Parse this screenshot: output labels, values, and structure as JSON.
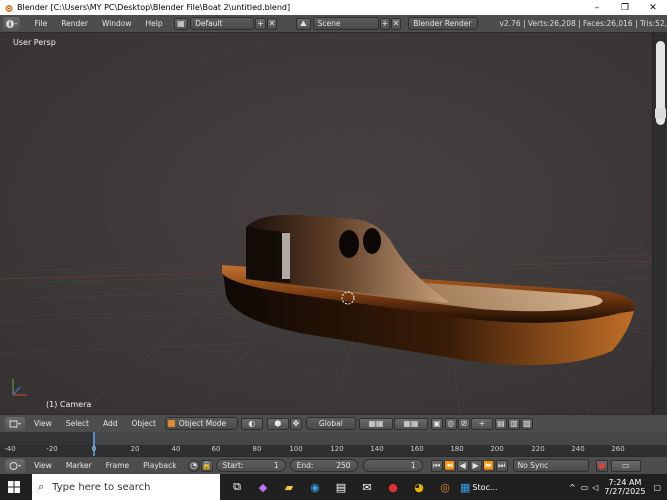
{
  "window": {
    "title": "Blender [C:\\Users\\MY PC\\Desktop\\Blender File\\Boat 2\\untitled.blend]",
    "minimize": "–",
    "maximize": "❐",
    "close": "✕"
  },
  "infobar": {
    "menus": [
      "File",
      "Render",
      "Window",
      "Help"
    ],
    "layout": "Default",
    "scene": "Scene",
    "engine": "Blender Render",
    "stats": "v2.76 | Verts:26,208 | Faces:26,016 | Tris:52,"
  },
  "viewport": {
    "view_label": "User Persp",
    "object_label": "(1) Camera"
  },
  "view_header": {
    "menus": [
      "View",
      "Select",
      "Add",
      "Object"
    ],
    "mode": "Object Mode",
    "orientation": "Global"
  },
  "timeline": {
    "ticks": [
      "-40",
      "-20",
      "0",
      "20",
      "40",
      "60",
      "80",
      "100",
      "120",
      "140",
      "160",
      "180",
      "200",
      "220",
      "240",
      "260"
    ]
  },
  "timeline_header": {
    "menus": [
      "View",
      "Marker",
      "Frame",
      "Playback"
    ],
    "start_label": "Start:",
    "start_value": "1",
    "end_label": "End:",
    "end_value": "250",
    "current_frame": "1",
    "sync": "No Sync"
  },
  "taskbar": {
    "search_placeholder": "Type here to search",
    "stocks_label": "Stoc...",
    "time": "7:24 AM",
    "date": "7/27/2025"
  },
  "colors": {
    "accent": "#4f8bd6",
    "boat_orange": "#b06420",
    "header": "#4d4d4d"
  }
}
